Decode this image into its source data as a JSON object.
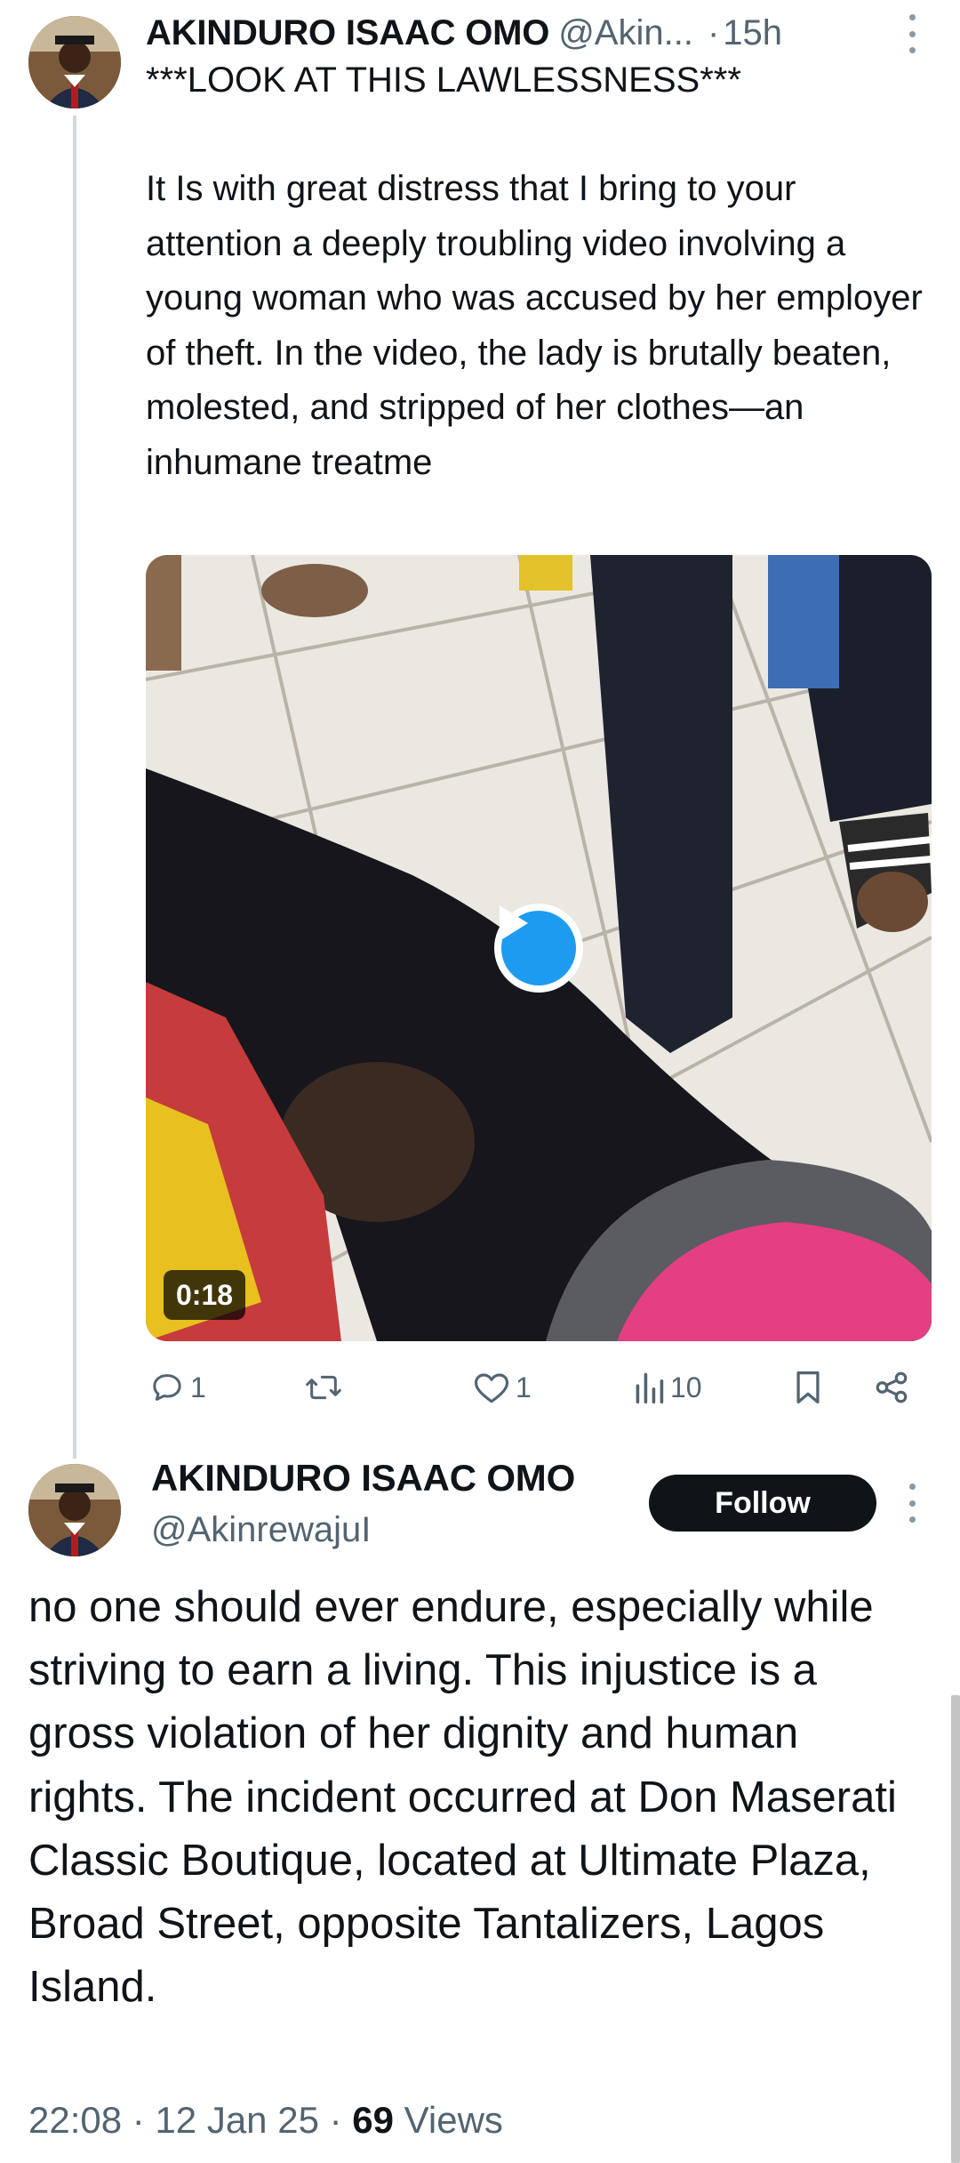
{
  "tweet1": {
    "name": "AKINDURO ISAAC OMO",
    "handle": "@Akin...",
    "separator": "·",
    "time": "15h",
    "headline": "***LOOK AT THIS LAWLESSNESS***",
    "body": "It Is with great distress that I bring to your attention a deeply troubling video involving a young woman who was accused by her employer of theft. In the video, the lady is brutally beaten, molested, and stripped of her clothes—an inhumane treatme",
    "video": {
      "duration": "0:18",
      "play_icon": "play-icon"
    },
    "actions": {
      "replies": "1",
      "reposts": "",
      "likes": "1",
      "views": "10"
    }
  },
  "tweet2": {
    "name": "AKINDURO ISAAC OMO",
    "handle": "@AkinrewajuI",
    "follow_label": "Follow",
    "body": "no one should ever endure, especially while striving to earn a living. This injustice is a gross violation of her dignity and human rights. The incident occurred at Don Maserati Classic Boutique, located at Ultimate Plaza, Broad Street, opposite Tantalizers, Lagos Island.",
    "meta": {
      "time": "22:08",
      "date": "12 Jan 25",
      "views_count": "69",
      "views_label": "Views"
    }
  },
  "colors": {
    "text": "#0f1419",
    "secondary": "#536471",
    "accent": "#1d9bf0",
    "follow_bg": "#0f1419",
    "thread_line": "#cfd9de"
  },
  "icons": [
    "reply-icon",
    "repost-icon",
    "like-icon",
    "views-icon",
    "bookmark-icon",
    "share-icon",
    "more-icon",
    "play-icon"
  ]
}
